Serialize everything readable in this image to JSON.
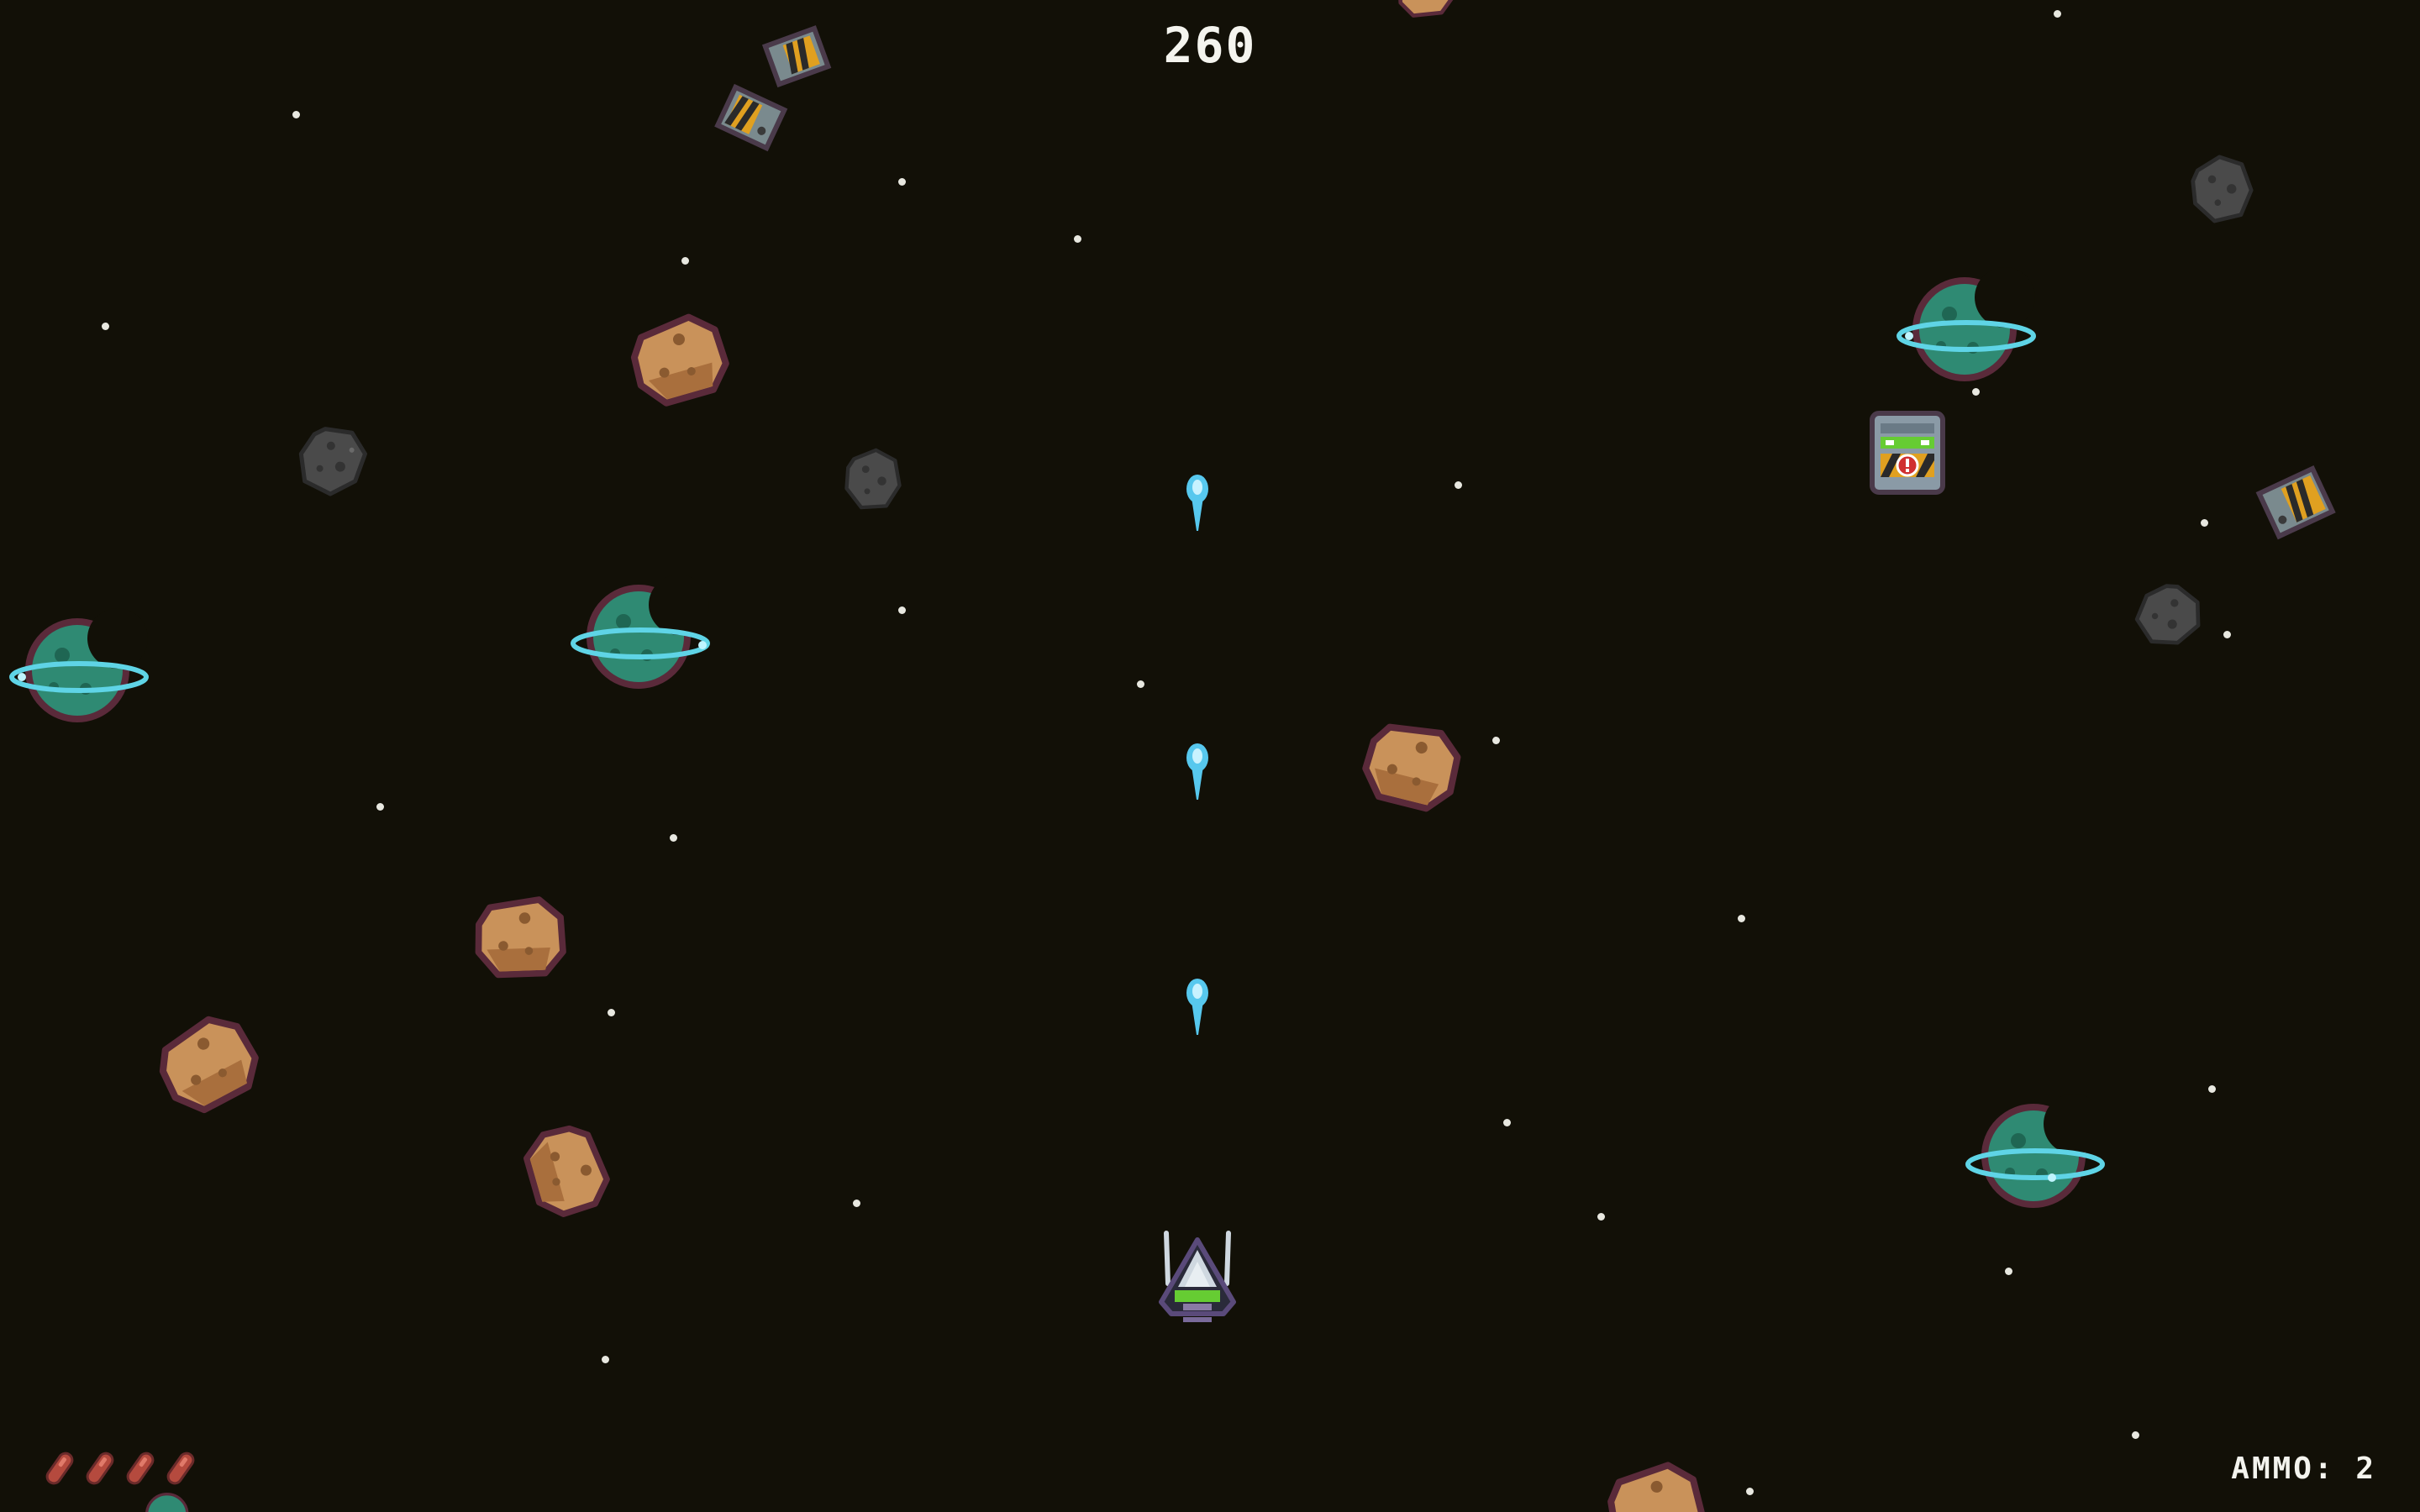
{
  "hud": {
    "score": "260",
    "ammo_label": "AMMO: 2",
    "lives_remaining": 4
  },
  "colors": {
    "background": "#121007",
    "star": "#e8e8e0",
    "hud_text": "#f4f4ee",
    "laser": "#57c8ee",
    "planet": "#2f8a73",
    "planet_ring": "#5fd4e6",
    "rock_asteroid": "#c9925a",
    "dark_asteroid": "#4a4a4a",
    "life_marker": "#b54a3e",
    "player_ship_accent": "#66cc33"
  },
  "icons": {
    "player": "player-ship-icon",
    "laser": "laser-bolt-icon",
    "planet": "ringed-planet-icon",
    "rock": "rock-asteroid-icon",
    "dark": "dark-asteroid-icon",
    "debris": "hazard-debris-icon",
    "powerup": "ammo-crate-icon",
    "life": "life-marker-icon"
  }
}
